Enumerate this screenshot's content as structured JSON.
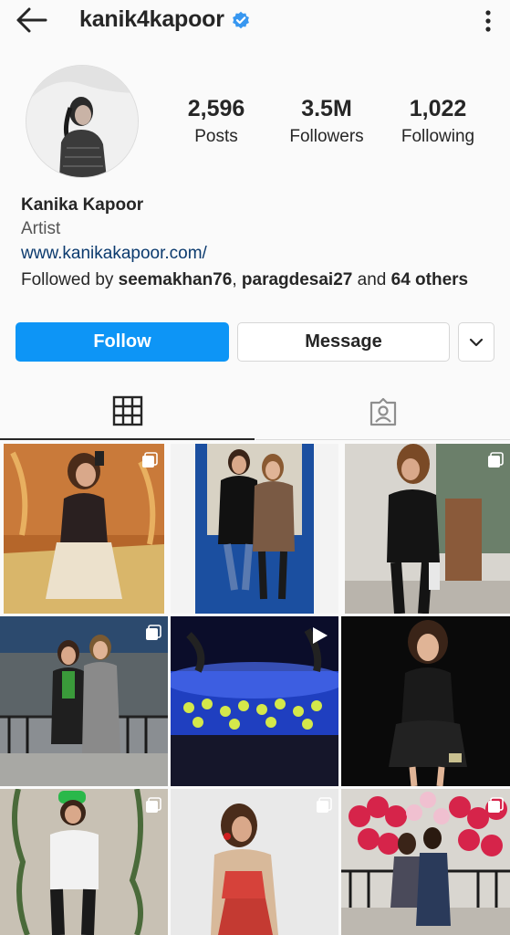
{
  "header": {
    "username": "kanik4kapoor",
    "back_icon": "back-arrow-icon",
    "verified_icon": "verified-badge-icon",
    "more_icon": "more-options-icon"
  },
  "profile": {
    "posts_count": "2,596",
    "posts_label": "Posts",
    "followers_count": "3.5M",
    "followers_label": "Followers",
    "following_count": "1,022",
    "following_label": "Following",
    "name": "Kanika Kapoor",
    "category": "Artist",
    "website": "www.kanikakapoor.com/",
    "followed_by_prefix": "Followed by ",
    "followed_by_user1": "seemakhan76",
    "followed_by_sep": ", ",
    "followed_by_user2": "paragdesai27",
    "followed_by_and": " and ",
    "followed_by_others": "64 others"
  },
  "actions": {
    "follow_label": "Follow",
    "message_label": "Message",
    "dropdown_icon": "chevron-down-icon"
  },
  "tabs": {
    "grid_icon": "grid-icon",
    "tagged_icon": "tagged-icon",
    "active": "grid"
  },
  "colors": {
    "accent": "#0d95f6",
    "verified": "#3897f0",
    "background": "#fafafa",
    "link": "#0b3a6e"
  },
  "posts": [
    {
      "badge": "multi-image-icon",
      "scene": "woman in lace skirt, selfie in ornate room"
    },
    {
      "badge": "none",
      "scene": "two women in fur coats at blue doorway"
    },
    {
      "badge": "multi-image-icon",
      "scene": "woman in black leather outfit on street"
    },
    {
      "badge": "multi-image-icon",
      "scene": "two women in coats by iron fence"
    },
    {
      "badge": "video-icon",
      "scene": "concert crowd under blue stage lights"
    },
    {
      "badge": "none",
      "scene": "woman in black sparkly dress, dark background"
    },
    {
      "badge": "multi-image-icon",
      "scene": "woman in green cap against wall"
    },
    {
      "badge": "multi-image-icon",
      "scene": "woman in embroidered outfit, white background"
    },
    {
      "badge": "multi-image-icon",
      "scene": "couple in front of heart flower display"
    }
  ]
}
